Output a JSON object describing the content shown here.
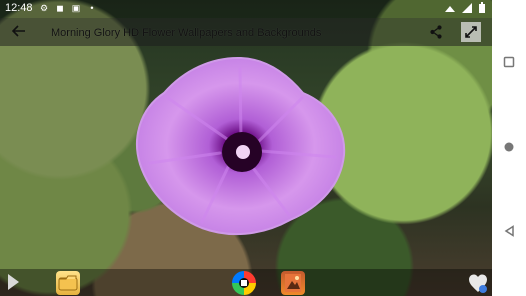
{
  "status_bar": {
    "time": "12:48"
  },
  "app_bar": {
    "title": "Morning Glory HD Flower Wallpapers and Backgrounds"
  },
  "accent_colors": {
    "flower": "#b878e2",
    "leaf": "#7ea750",
    "navbar": "#ffffff"
  }
}
